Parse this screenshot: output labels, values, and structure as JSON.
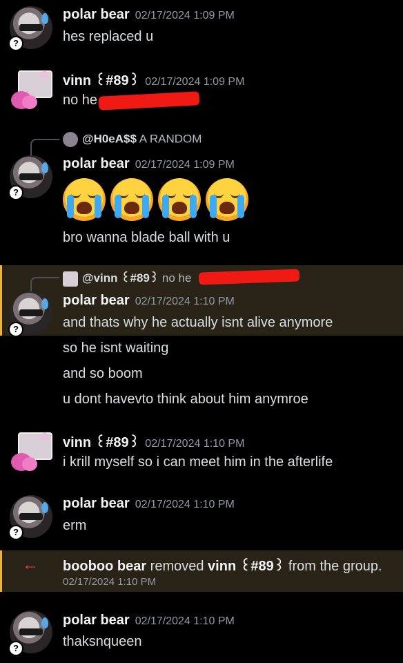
{
  "messages": [
    {
      "author": "polar bear",
      "time": "02/17/2024 1:09 PM",
      "text": "hes replaced u"
    },
    {
      "author": "vinn ꒰#89꒱",
      "time": "02/17/2024 1:09 PM",
      "text": "no he"
    },
    {
      "reply_to": "@H0eA$$",
      "reply_text": "A RANDOM",
      "author": "polar bear",
      "time": "02/17/2024 1:09 PM",
      "emojis": [
        "loudly-crying-face",
        "loudly-crying-face",
        "loudly-crying-face",
        "loudly-crying-face"
      ],
      "text": "bro wanna blade ball with u"
    },
    {
      "reply_to": "@vinn ꒰#89꒱",
      "reply_text": "no he",
      "author": "polar bear",
      "time": "02/17/2024 1:10 PM",
      "lines": [
        "and thats why he actually isnt alive anymore",
        "so he isnt waiting",
        "and so boom",
        "u dont havevto think about him anymroe"
      ]
    },
    {
      "author": "vinn ꒰#89꒱",
      "time": "02/17/2024 1:10 PM",
      "text": "i krill myself so i can meet him in the afterlife"
    },
    {
      "author": "polar bear",
      "time": "02/17/2024 1:10 PM",
      "text": "erm"
    },
    {
      "author": "polar bear",
      "time": "02/17/2024 1:10 PM",
      "text": "thaksnqueen"
    }
  ],
  "system": {
    "actor": "booboo bear",
    "action": " removed ",
    "target": "vinn ꒰#89꒱",
    "suffix": " from the group.",
    "time": "02/17/2024 1:10 PM"
  },
  "badge_char": "?",
  "colors": {
    "background": "#000000",
    "highlight": "#2a2418",
    "mention_bar": "#f0b232",
    "redaction": "#f01a14",
    "leave_arrow": "#f23f42"
  }
}
